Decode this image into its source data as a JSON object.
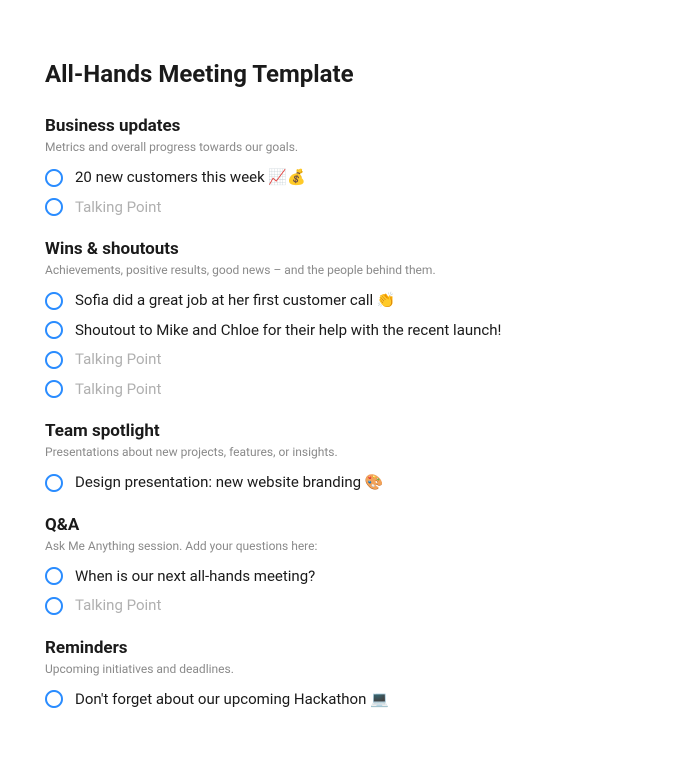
{
  "title": "All-Hands Meeting Template",
  "sections": [
    {
      "title": "Business updates",
      "subtitle": "Metrics and overall progress towards our goals.",
      "items": [
        {
          "text": "20 new customers this week 📈💰",
          "placeholder": false
        },
        {
          "text": "Talking Point",
          "placeholder": true
        }
      ]
    },
    {
      "title": "Wins & shoutouts",
      "subtitle": "Achievements, positive results, good news – and the people behind them.",
      "items": [
        {
          "text": "Sofia did a great job at her first customer call 👏",
          "placeholder": false
        },
        {
          "text": "Shoutout to Mike and Chloe for their help with the recent launch!",
          "placeholder": false
        },
        {
          "text": "Talking Point",
          "placeholder": true
        },
        {
          "text": "Talking Point",
          "placeholder": true
        }
      ]
    },
    {
      "title": "Team spotlight",
      "subtitle": "Presentations about new projects, features, or insights.",
      "items": [
        {
          "text": "Design presentation: new website branding 🎨",
          "placeholder": false
        }
      ]
    },
    {
      "title": "Q&A",
      "subtitle": "Ask Me Anything session. Add your questions here:",
      "items": [
        {
          "text": "When is our next all-hands meeting?",
          "placeholder": false
        },
        {
          "text": "Talking Point",
          "placeholder": true
        }
      ]
    },
    {
      "title": "Reminders",
      "subtitle": "Upcoming initiatives and deadlines.",
      "items": [
        {
          "text": "Don't forget about our upcoming Hackathon 💻",
          "placeholder": false
        }
      ]
    }
  ]
}
